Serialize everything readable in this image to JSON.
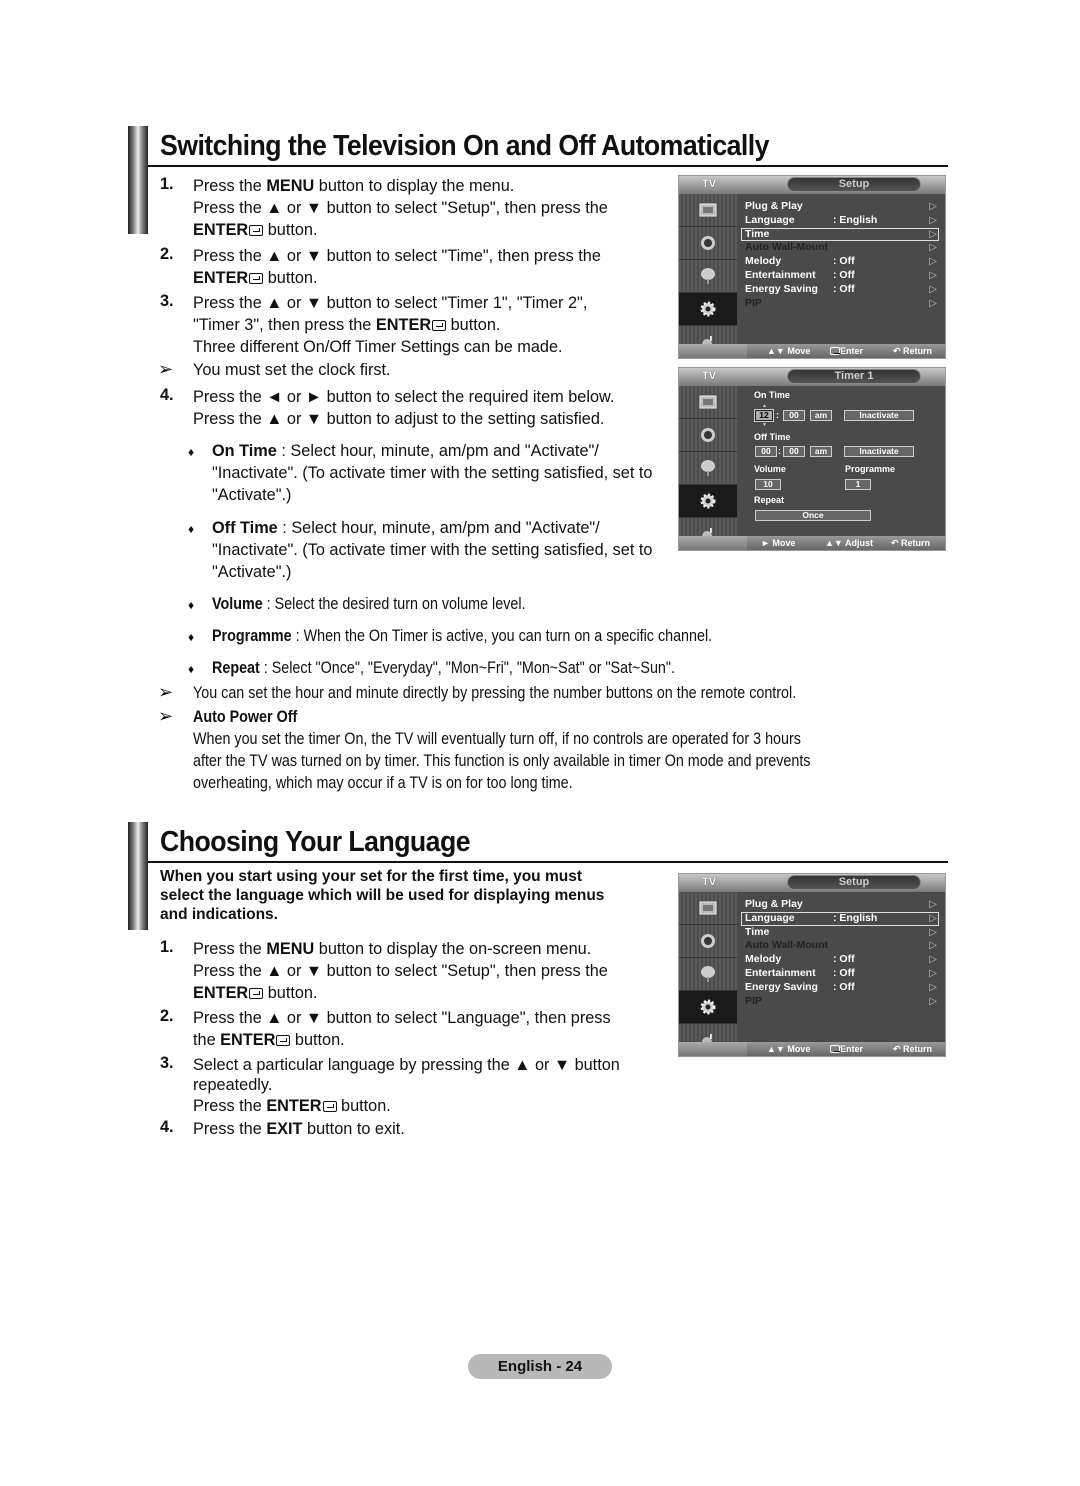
{
  "section1": {
    "title": "Switching the Television On and Off Automatically",
    "steps": [
      {
        "num": "1.",
        "lines": [
          {
            "pre": "Press the ",
            "bold": "MENU",
            "post": " button to display the menu."
          },
          {
            "pre": "Press the ▲ or ▼ button to select \"Setup\", then press the",
            "bold": "",
            "post": ""
          },
          {
            "pre": "",
            "bold": "ENTER",
            "post": " button.",
            "enter": true
          }
        ]
      },
      {
        "num": "2.",
        "lines": [
          {
            "pre": "Press the ▲ or ▼ button to select \"Time\", then press the",
            "bold": "",
            "post": ""
          },
          {
            "pre": "",
            "bold": "ENTER",
            "post": " button.",
            "enter": true
          }
        ]
      },
      {
        "num": "3.",
        "lines": [
          {
            "pre": "Press the ▲ or ▼ button to select \"Timer 1\", \"Timer 2\",",
            "bold": "",
            "post": ""
          },
          {
            "pre": "\"Timer 3\", then press the ",
            "bold": "ENTER",
            "post": " button.",
            "enter": true
          },
          {
            "pre": "Three different On/Off Timer Settings can be made.",
            "bold": "",
            "post": ""
          }
        ]
      }
    ],
    "note1": "You must set the clock first.",
    "step4": {
      "num": "4.",
      "line1": "Press the ◄ or ► button to select the required item below.",
      "line2": "Press the ▲ or ▼ button to adjust to the setting satisfied."
    },
    "bullets": [
      {
        "term": "On Time",
        "text": " : Select hour, minute, am/pm and \"Activate\"/",
        "cont": [
          "\"Inactivate\". (To activate timer with the setting satisfied, set to",
          "\"Activate\".)"
        ]
      },
      {
        "term": "Off Time",
        "text": " : Select hour, minute, am/pm and \"Activate\"/",
        "cont": [
          "\"Inactivate\". (To activate timer with the setting satisfied, set to",
          "\"Activate\".)"
        ]
      },
      {
        "term": "Volume",
        "text": " : Select the desired turn on volume level.",
        "cont": []
      },
      {
        "term": "Programme",
        "text": " : When the On Timer is active, you can turn on a specific channel.",
        "cont": []
      },
      {
        "term": "Repeat",
        "text": " : Select \"Once\", \"Everyday\", \"Mon~Fri\", \"Mon~Sat\" or \"Sat~Sun\".",
        "cont": []
      }
    ],
    "note2": "You can set the hour and minute directly by pressing the number buttons on the remote control.",
    "note3_title": "Auto Power Off",
    "note3_lines": [
      "When you set the timer On, the TV will eventually turn off, if no controls are operated for 3 hours",
      "after the TV was turned on by timer. This function is only available in timer On mode and prevents",
      "overheating, which may occur if a TV is on for too long time."
    ]
  },
  "section2": {
    "title": "Choosing Your Language",
    "intro": [
      "When you start using your set for the first time, you must",
      "select the language which will be used for displaying menus",
      "and indications."
    ],
    "steps": [
      {
        "num": "1.",
        "lines": [
          {
            "pre": "Press the ",
            "bold": "MENU",
            "post": " button to display the on-screen menu."
          },
          {
            "pre": "Press the ▲ or ▼ button to select \"Setup\", then press the",
            "bold": "",
            "post": ""
          },
          {
            "pre": "",
            "bold": "ENTER",
            "post": " button.",
            "enter": true
          }
        ]
      },
      {
        "num": "2.",
        "lines": [
          {
            "pre": "Press the ▲ or ▼ button to select \"Language\", then press",
            "bold": "",
            "post": ""
          },
          {
            "pre": "the ",
            "bold": "ENTER",
            "post": " button.",
            "enter": true
          }
        ]
      },
      {
        "num": "3.",
        "lines": [
          {
            "pre": "Select a particular language by pressing the ▲ or ▼ button",
            "bold": "",
            "post": ""
          },
          {
            "pre": "repeatedly.",
            "bold": "",
            "post": ""
          },
          {
            "pre": "Press the ",
            "bold": "ENTER",
            "post": " button.",
            "enter": true
          }
        ]
      },
      {
        "num": "4.",
        "lines": [
          {
            "pre": "Press the ",
            "bold": "EXIT",
            "post": " button to exit."
          }
        ]
      }
    ]
  },
  "osd_setup_time": {
    "tv_label": "TV",
    "title": "Setup",
    "items": [
      {
        "label": "Plug & Play",
        "value": "",
        "state": "normal"
      },
      {
        "label": "Language",
        "value": ": English",
        "state": "normal"
      },
      {
        "label": "Time",
        "value": "",
        "state": "selected"
      },
      {
        "label": "Auto Wall-Mount",
        "value": "",
        "state": "disabled"
      },
      {
        "label": "Melody",
        "value": ": Off",
        "state": "normal"
      },
      {
        "label": "Entertainment",
        "value": ": Off",
        "state": "normal"
      },
      {
        "label": "Energy Saving",
        "value": ": Off",
        "state": "normal"
      },
      {
        "label": "PIP",
        "value": "",
        "state": "disabled"
      }
    ],
    "footer": {
      "move": "▲▼ Move",
      "enter": "Enter",
      "return": "↶ Return"
    }
  },
  "osd_timer": {
    "tv_label": "TV",
    "title": "Timer 1",
    "on_time_label": "On Time",
    "on_hour": "12",
    "on_min": "00",
    "on_ampm": "am",
    "on_state": "Inactivate",
    "off_time_label": "Off Time",
    "off_hour": "00",
    "off_min": "00",
    "off_ampm": "am",
    "off_state": "Inactivate",
    "volume_label": "Volume",
    "volume_value": "10",
    "programme_label": "Programme",
    "programme_value": "1",
    "repeat_label": "Repeat",
    "repeat_value": "Once",
    "footer": {
      "move": "► Move",
      "adjust": "▲▼ Adjust",
      "return": "↶ Return"
    }
  },
  "osd_setup_language": {
    "tv_label": "TV",
    "title": "Setup",
    "items": [
      {
        "label": "Plug & Play",
        "value": "",
        "state": "normal"
      },
      {
        "label": "Language",
        "value": ": English",
        "state": "selected"
      },
      {
        "label": "Time",
        "value": "",
        "state": "normal"
      },
      {
        "label": "Auto Wall-Mount",
        "value": "",
        "state": "disabled"
      },
      {
        "label": "Melody",
        "value": ": Off",
        "state": "normal"
      },
      {
        "label": "Entertainment",
        "value": ": Off",
        "state": "normal"
      },
      {
        "label": "Energy Saving",
        "value": ": Off",
        "state": "normal"
      },
      {
        "label": "PIP",
        "value": "",
        "state": "disabled"
      }
    ],
    "footer": {
      "move": "▲▼ Move",
      "enter": "Enter",
      "return": "↶ Return"
    }
  },
  "footer": {
    "page_label": "English - 24"
  }
}
